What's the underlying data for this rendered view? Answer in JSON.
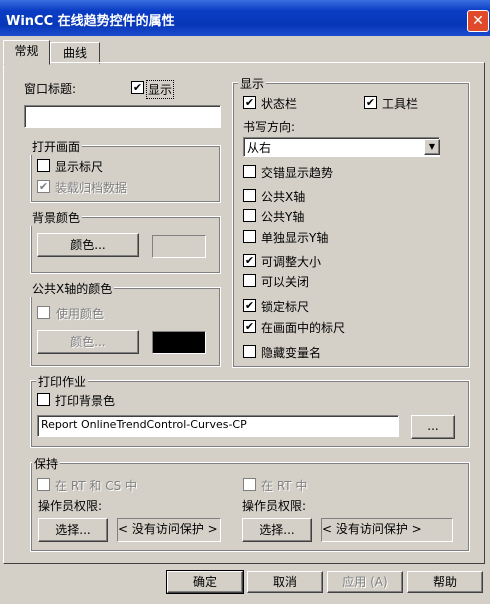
{
  "window": {
    "title": "WinCC 在线趋势控件的属性",
    "close": "✕"
  },
  "tabs": [
    {
      "label": "常规"
    },
    {
      "label": "曲线"
    }
  ],
  "window_title": {
    "label": "窗口标题:",
    "show_label": "显示",
    "show_checked": true,
    "value": ""
  },
  "open_view": {
    "legend": "打开画面",
    "show_scale": "显示标尺",
    "load_archive": "装载归档数据"
  },
  "bg_color": {
    "legend": "背景颜色",
    "button": "颜色..."
  },
  "common_x_color": {
    "legend": "公共X轴的颜色",
    "use_color": "使用颜色",
    "button": "颜色...",
    "swatch": "#000000"
  },
  "display": {
    "legend": "显示",
    "statusbar": "状态栏",
    "toolbar": "工具栏",
    "write_direction_label": "书写方向:",
    "write_direction_value": "从右",
    "dropdown_arrow": "▼",
    "staggered": "交错显示趋势",
    "common_x": "公共X轴",
    "common_y": "公共Y轴",
    "separate_y": "单独显示Y轴",
    "resizable": "可调整大小",
    "closable": "可以关闭",
    "lock_scale": "锁定标尺",
    "scale_in_view": "在画面中的标尺",
    "hide_var": "隐藏变量名"
  },
  "print_job": {
    "legend": "打印作业",
    "print_bg": "打印背景色",
    "job_value": "Report OnlineTrendControl-Curves-CP",
    "browse": "..."
  },
  "persist": {
    "legend": "保持",
    "rt_cs": "在 RT 和 CS 中",
    "rt": "在 RT 中",
    "operator_rights_left": "操作员权限:",
    "operator_rights_right": "操作员权限:",
    "select_left": "选择...",
    "select_right": "选择...",
    "no_access_left": "< 没有访问保护 >",
    "no_access_right": "< 没有访问保护 >"
  },
  "footer": {
    "ok": "确定",
    "cancel": "取消",
    "apply": "应用 (A)",
    "help": "帮助"
  }
}
